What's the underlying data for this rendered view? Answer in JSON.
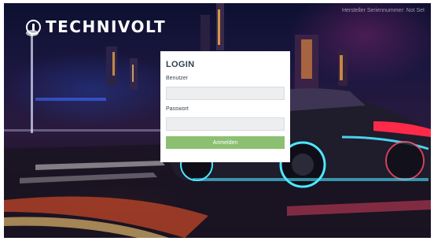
{
  "brand": {
    "name": "TECHNIVOLT",
    "icon": "power-bulb-icon"
  },
  "serial": {
    "text": "Hersteller Seriennummer: Not Set"
  },
  "login": {
    "title": "LOGIN",
    "username_label": "Benutzer",
    "username_value": "",
    "password_label": "Passwort",
    "password_value": "",
    "submit_label": "Anmelden"
  },
  "colors": {
    "submit_button": "#8cc071",
    "title_text": "#2f3f52",
    "input_bg": "#eceef0"
  }
}
